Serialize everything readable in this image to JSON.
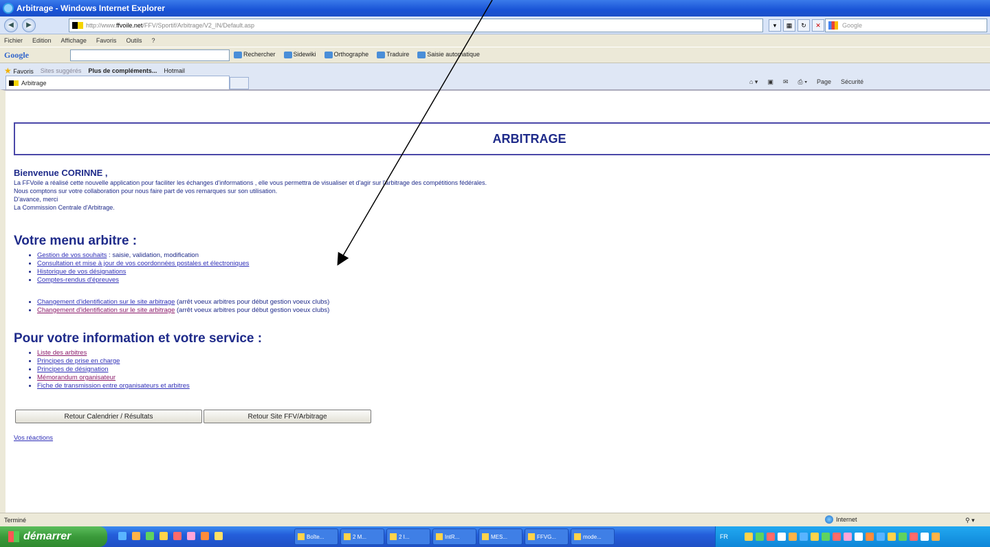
{
  "window": {
    "title": "Arbitrage - Windows Internet Explorer"
  },
  "address": {
    "url_prefix": "http://www.",
    "url_domain": "ffvoile.net",
    "url_rest": "/FFV/Sportif/Arbitrage/V2_IN/Default.asp",
    "search_placeholder": "Google"
  },
  "menubar": {
    "items": [
      "Fichier",
      "Edition",
      "Affichage",
      "Favoris",
      "Outils",
      "?"
    ]
  },
  "google_toolbar": {
    "label": "Google",
    "items": [
      "Rechercher",
      "Sidewiki",
      "Orthographe",
      "Traduire",
      "Saisie automatique"
    ]
  },
  "favbar": {
    "favoris": "Favoris",
    "sites_suggeres": "Sites suggérés",
    "plus": "Plus de compléments...",
    "hotmail": "Hotmail",
    "tab_label": "Arbitrage",
    "cmd": [
      "Page",
      "Sécurité"
    ]
  },
  "page": {
    "banner": "ARBITRAGE",
    "welcome": "Bienvenue CORINNE ,",
    "intro": [
      "La FFVoile a réalisé cette nouvelle application pour faciliter les échanges d'informations , elle vous permettra de visualiser et d'agir sur l'arbitrage des compétitions fédérales.",
      "Nous comptons sur votre collaboration pour nous faire part de vos remarques sur son utilisation.",
      "D'avance, merci",
      "La Commission Centrale d'Arbitrage."
    ],
    "menu_title": "Votre menu arbitre :",
    "menu_links": [
      {
        "link": "Gestion de vos souhaits",
        "suffix": " : saisie, validation, modification"
      },
      {
        "link": "Consultation et mise à jour de vos coordonnées postales et électroniques",
        "suffix": ""
      },
      {
        "link": "Historique de vos désignations",
        "suffix": ""
      },
      {
        "link": "Comptes-rendus d'épreuves",
        "suffix": ""
      }
    ],
    "id_links": [
      {
        "link": "Changement d'identification sur le site arbitrage",
        "suffix": " (arrêt voeux arbitres pour début gestion voeux clubs)"
      },
      {
        "link": "Changement d'identification sur le site arbitrage",
        "suffix": " (arrêt voeux arbitres pour début gestion voeux clubs)"
      }
    ],
    "info_title": "Pour votre information et votre service :",
    "info_links": [
      "Liste des arbitres",
      "Principes de prise en charge",
      "Principes de désignation",
      "Mémorandum organisateur",
      "Fiche de transmission entre organisateurs et arbitres"
    ],
    "button_calendar": "Retour Calendrier / Résultats",
    "button_site": "Retour Site FFV/Arbitrage",
    "reactions": "Vos réactions"
  },
  "status": {
    "text": "Terminé",
    "zone": "Internet"
  },
  "taskbar": {
    "start": "démarrer",
    "tasks": [
      "Boîte...",
      "2 M...",
      "2 I...",
      "IntR...",
      "MES...",
      "FFVG...",
      "mode..."
    ],
    "lang": "FR"
  },
  "colors": {
    "heading": "#1f2b8a",
    "link": "#3030b8",
    "visited": "#8b1a6a"
  }
}
